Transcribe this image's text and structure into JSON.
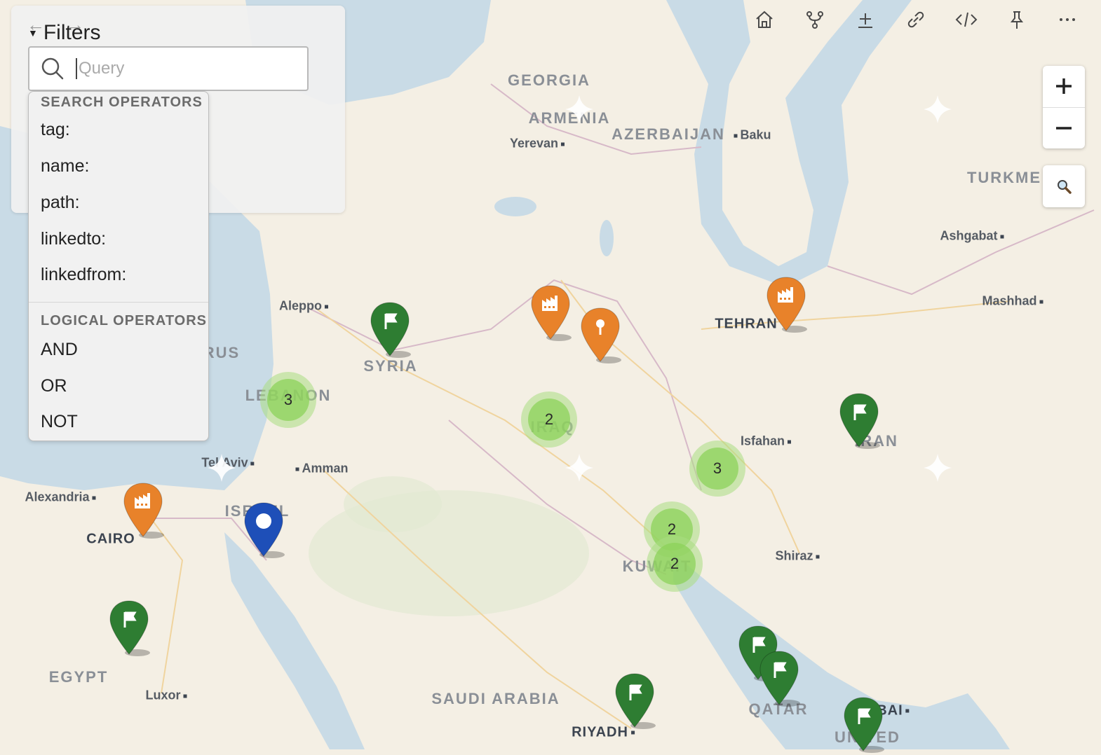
{
  "toolbar": {
    "icons": [
      "home-icon",
      "fork-icon",
      "plus-line-icon",
      "link-icon",
      "code-icon",
      "pin-icon",
      "more-icon"
    ]
  },
  "filters": {
    "title": "Filters",
    "query_placeholder": "Query",
    "search_heading": "SEARCH OPERATORS",
    "search_ops": [
      "tag:",
      "name:",
      "path:",
      "linkedto:",
      "linkedfrom:"
    ],
    "logical_heading": "LOGICAL OPERATORS",
    "logical_ops": [
      "AND",
      "OR",
      "NOT"
    ]
  },
  "map": {
    "countries": [
      "GEORGIA",
      "ARMENIA",
      "AZERBAIJAN",
      "TURKME",
      "SYRIA",
      "LEBANON",
      "IRAQ",
      "IRAN",
      "ISRAEL",
      "KUWAIT",
      "EGYPT",
      "SAUDI ARABIA",
      "QATAR",
      "UNITED",
      "RUS"
    ],
    "cities": [
      "Yerevan",
      "Baku",
      "Ashgabat",
      "Mashhad",
      "Aleppo",
      "TEHRAN",
      "Isfahan",
      "Tel Aviv",
      "Amman",
      "Alexandria",
      "CAIRO",
      "Shiraz",
      "Luxor",
      "RIYADH",
      "DUBAI"
    ],
    "clusters": [
      "3",
      "2",
      "3",
      "2",
      "2"
    ],
    "markers": [
      "flag",
      "factory",
      "pin",
      "factory",
      "flag",
      "factory",
      "dot",
      "flag",
      "flag",
      "flag",
      "flag",
      "flag"
    ],
    "colors": {
      "green": "#2e7d32",
      "orange": "#e8822a",
      "blue": "#1e4fb8",
      "water": "#c9dbe6",
      "land": "#f4efe4"
    }
  }
}
